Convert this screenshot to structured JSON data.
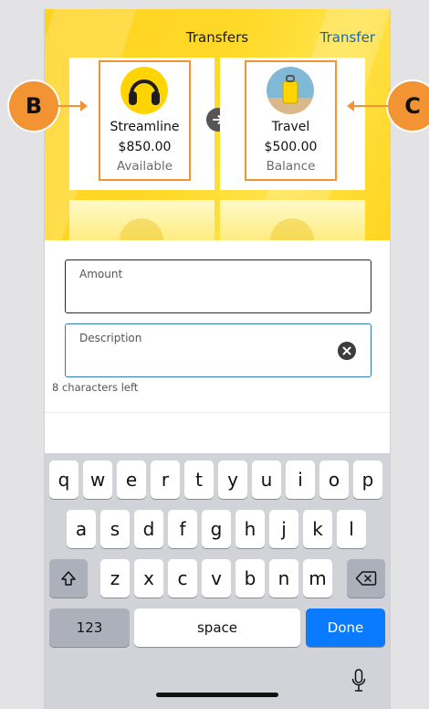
{
  "header": {
    "title": "Transfers",
    "action_label": "Transfer",
    "colors": {
      "accent_yellow": "#ffd21f",
      "link_blue": "#1e66a6",
      "highlight_orange": "#f29433"
    }
  },
  "accounts": [
    {
      "name": "Streamline",
      "amount": "$850.00",
      "sub": "Available",
      "icon": "headphones-avatar"
    },
    {
      "name": "Travel",
      "amount": "$500.00",
      "sub": "Balance",
      "icon": "suitcase-avatar"
    }
  ],
  "markers": {
    "left": "B",
    "right": "C"
  },
  "form": {
    "amount": {
      "label": "Amount",
      "value": ""
    },
    "description": {
      "label": "Description",
      "value": "",
      "helper": "8 characters left"
    }
  },
  "keyboard": {
    "row1": [
      "q",
      "w",
      "e",
      "r",
      "t",
      "y",
      "u",
      "i",
      "o",
      "p"
    ],
    "row2": [
      "a",
      "s",
      "d",
      "f",
      "g",
      "h",
      "j",
      "k",
      "l"
    ],
    "row3": [
      "z",
      "x",
      "c",
      "v",
      "b",
      "n",
      "m"
    ],
    "numbers_label": "123",
    "space_label": "space",
    "done_label": "Done"
  }
}
